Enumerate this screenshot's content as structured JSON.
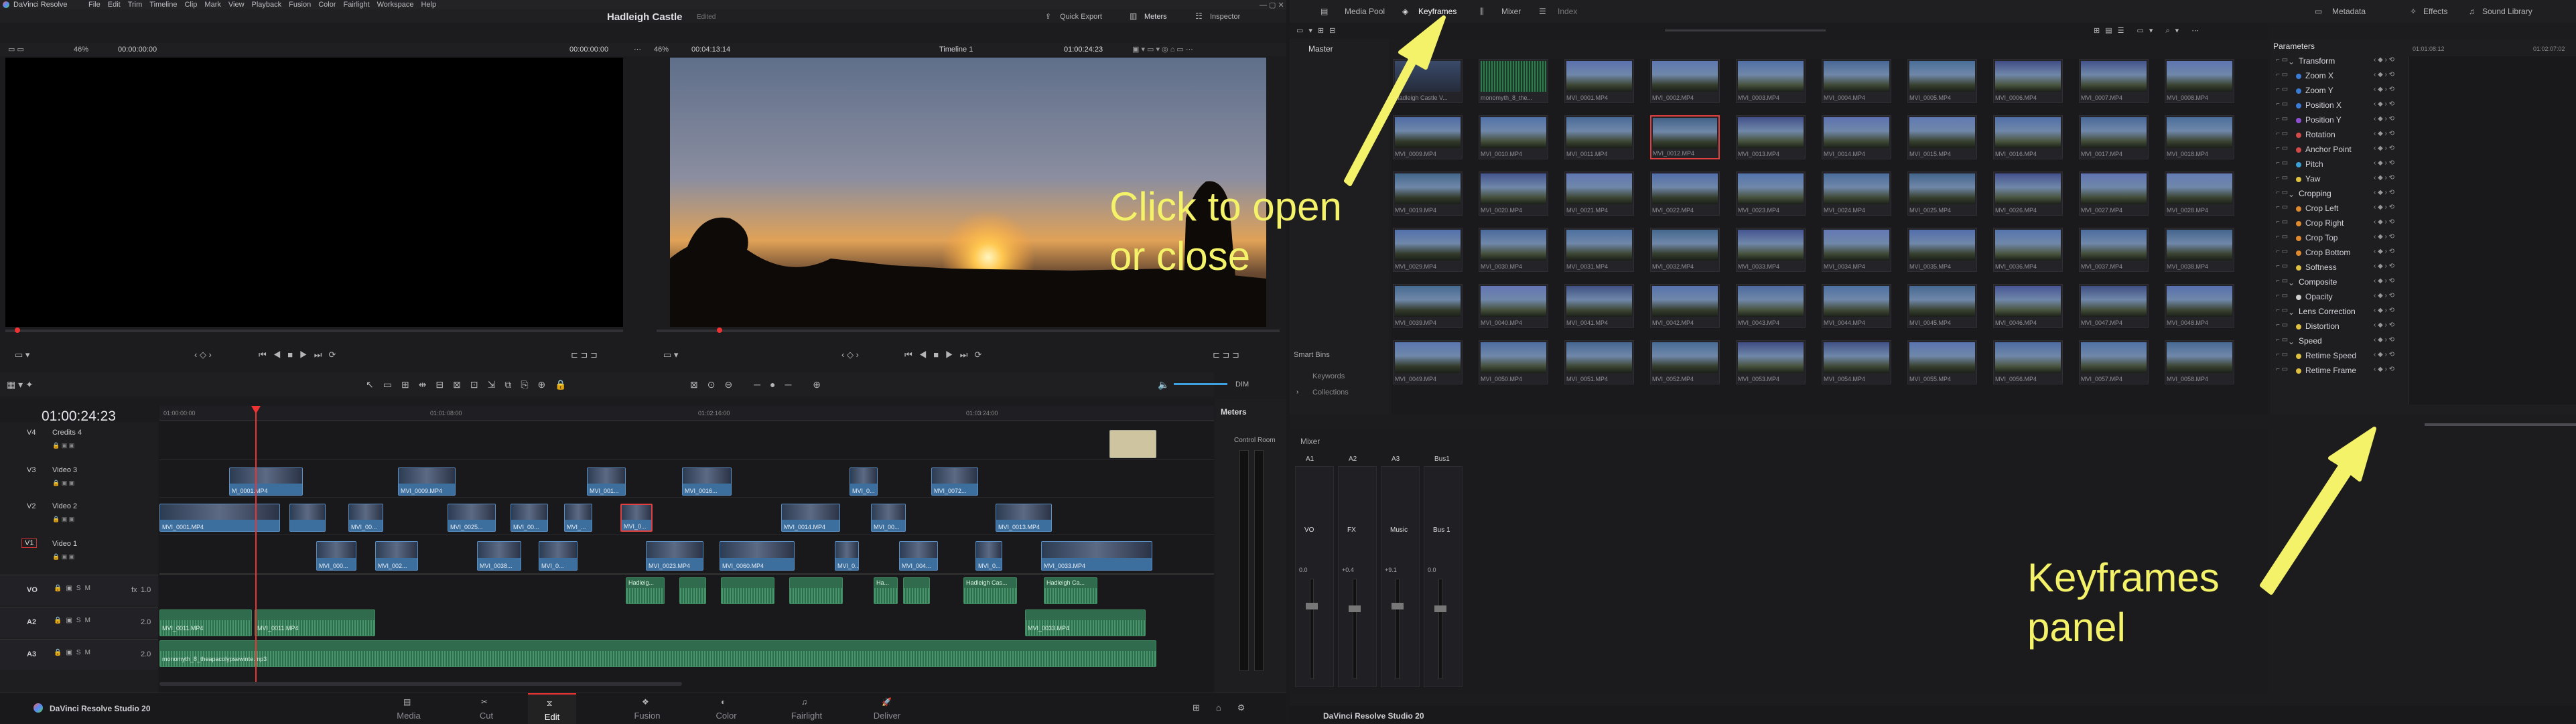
{
  "app": {
    "name_left": "DaVinci Resolve",
    "menu": [
      "File",
      "Edit",
      "Trim",
      "Timeline",
      "Clip",
      "Mark",
      "View",
      "Playback",
      "Fusion",
      "Color",
      "Fairlight",
      "Workspace",
      "Help"
    ],
    "project_title": "Hadleigh Castle",
    "project_status": "Edited",
    "top_buttons": {
      "quick_export": "Quick Export",
      "meters": "Meters",
      "inspector": "Inspector"
    },
    "right_top_tabs": {
      "media_pool": "Media Pool",
      "keyframes": "Keyframes",
      "mixer": "Mixer",
      "index": "Index",
      "metadata": "Metadata",
      "effects": "Effects",
      "sound_library": "Sound Library"
    }
  },
  "source_viewer": {
    "zoom": "46%",
    "timecode_left": "00:00:00:00",
    "timecode_right": "00:00:00:00"
  },
  "timeline_viewer": {
    "zoom": "46%",
    "duration": "00:04:13:14",
    "timeline_name": "Timeline 1",
    "timecode": "01:00:24:23"
  },
  "timeline": {
    "current_tc": "01:00:24:23",
    "ruler": [
      "01:00:00:00",
      "01:01:08:00",
      "01:02:16:00",
      "01:03:24:00"
    ],
    "dim_label": "DIM",
    "tracks": {
      "v4": {
        "id": "V4",
        "name": "Credits 4"
      },
      "v3": {
        "id": "V3",
        "name": "Video 3"
      },
      "v2": {
        "id": "V2",
        "name": "Video 2"
      },
      "v1": {
        "id": "V1",
        "name": "Video 1"
      },
      "vo": {
        "id": "VO",
        "fx": "fx",
        "level": "1.0"
      },
      "a2": {
        "id": "A2",
        "level": "2.0"
      },
      "a3": {
        "id": "A3",
        "level": "2.0"
      }
    },
    "clips_v3": [
      "M_0001.MP4",
      "MVI_0009.MP4",
      "MVI_001...",
      "MVI_0016...",
      "MVI_0...",
      "MVI_0072..."
    ],
    "clips_v2": [
      "MVI_0001.MP4",
      "MVI_00...",
      "MVI_0025...",
      "MVI_00...",
      "MVI_...",
      "MVI_0...",
      "MVI_0014.MP4",
      "MVI_00...",
      "MVI_0013.MP4"
    ],
    "clips_v1": [
      "MVI_000...",
      "MVI_002...",
      "MVI_0038...",
      "MVI_0...",
      "MVI_0023.MP4",
      "MVI_0060.MP4",
      "MVI_0...",
      "MVI_004...",
      "MVI_0...",
      "MVI_0033.MP4"
    ],
    "clips_vo": [
      "Hadleig...",
      "Ha...",
      "Hadleigh Cas...",
      "Hadleigh Ca..."
    ],
    "clips_a2": [
      "MVI_0011.MP4",
      "MVI_0011.MP4",
      "MVI_0033.MP4"
    ],
    "clip_a3": "monomyth_8_theapacolypsewinte.mp3"
  },
  "meters": {
    "title": "Meters",
    "control_room": "Control Room"
  },
  "pages": [
    "Media",
    "Cut",
    "Edit",
    "Fusion",
    "Color",
    "Fairlight",
    "Deliver"
  ],
  "brand": "DaVinci Resolve Studio 20",
  "media_pool": {
    "master": "Master",
    "smart_bins": "Smart Bins",
    "keywords": "Keywords",
    "collections": "Collections",
    "clips": [
      "Hadleigh Castle V...",
      "monomyth_8_the...",
      "MVI_0001.MP4",
      "MVI_0002.MP4",
      "MVI_0003.MP4",
      "MVI_0004.MP4",
      "MVI_0005.MP4",
      "MVI_0006.MP4",
      "MVI_0007.MP4",
      "MVI_0008.MP4",
      "MVI_0009.MP4",
      "MVI_0010.MP4",
      "MVI_0011.MP4",
      "MVI_0012.MP4",
      "MVI_0013.MP4",
      "MVI_0014.MP4",
      "MVI_0015.MP4",
      "MVI_0016.MP4",
      "MVI_0017.MP4",
      "MVI_0018.MP4",
      "MVI_0019.MP4",
      "MVI_0020.MP4",
      "MVI_0021.MP4",
      "MVI_0022.MP4",
      "MVI_0023.MP4",
      "MVI_0024.MP4",
      "MVI_0025.MP4",
      "MVI_0026.MP4",
      "MVI_0027.MP4",
      "MVI_0028.MP4",
      "MVI_0029.MP4",
      "MVI_0030.MP4",
      "MVI_0031.MP4",
      "MVI_0032.MP4",
      "MVI_0033.MP4",
      "MVI_0034.MP4",
      "MVI_0035.MP4",
      "MVI_0036.MP4",
      "MVI_0037.MP4",
      "MVI_0038.MP4",
      "MVI_0039.MP4",
      "MVI_0040.MP4",
      "MVI_0041.MP4",
      "MVI_0042.MP4",
      "MVI_0043.MP4",
      "MVI_0044.MP4",
      "MVI_0045.MP4",
      "MVI_0046.MP4",
      "MVI_0047.MP4",
      "MVI_0048.MP4",
      "MVI_0049.MP4",
      "MVI_0050.MP4",
      "MVI_0051.MP4",
      "MVI_0052.MP4",
      "MVI_0053.MP4",
      "MVI_0054.MP4",
      "MVI_0055.MP4",
      "MVI_0056.MP4",
      "MVI_0057.MP4",
      "MVI_0058.MP4"
    ]
  },
  "mixer": {
    "title": "Mixer",
    "channels": [
      "A1",
      "A2",
      "A3",
      "Bus1"
    ],
    "labels": [
      "VO",
      "FX",
      "Music",
      "Bus 1"
    ],
    "levels": [
      "0.0",
      "+0.4",
      "+9.1",
      "0.0"
    ]
  },
  "keyframes": {
    "title": "Parameters",
    "ruler": [
      "01:01:08:12",
      "01:02:07:02"
    ],
    "params": [
      {
        "label": "Transform",
        "type": "group",
        "color": ""
      },
      {
        "label": "Zoom X",
        "type": "item",
        "color": "#3a7bd5"
      },
      {
        "label": "Zoom Y",
        "type": "item",
        "color": "#3a7bd5"
      },
      {
        "label": "Position X",
        "type": "item",
        "color": "#3a7bd5"
      },
      {
        "label": "Position Y",
        "type": "item",
        "color": "#8e4fd0"
      },
      {
        "label": "Rotation",
        "type": "item",
        "color": "#d44a4a"
      },
      {
        "label": "Anchor Point",
        "type": "item",
        "color": "#d44a4a"
      },
      {
        "label": "Pitch",
        "type": "item",
        "color": "#3aa0d5"
      },
      {
        "label": "Yaw",
        "type": "item",
        "color": "#e0c040"
      },
      {
        "label": "Cropping",
        "type": "group",
        "color": ""
      },
      {
        "label": "Crop Left",
        "type": "item",
        "color": "#e08a30"
      },
      {
        "label": "Crop Right",
        "type": "item",
        "color": "#e08a30"
      },
      {
        "label": "Crop Top",
        "type": "item",
        "color": "#e08a30"
      },
      {
        "label": "Crop Bottom",
        "type": "item",
        "color": "#e08a30"
      },
      {
        "label": "Softness",
        "type": "item",
        "color": "#e0c040"
      },
      {
        "label": "Composite",
        "type": "group",
        "color": ""
      },
      {
        "label": "Opacity",
        "type": "item",
        "color": "#cfcfcf"
      },
      {
        "label": "Lens Correction",
        "type": "group",
        "color": ""
      },
      {
        "label": "Distortion",
        "type": "item",
        "color": "#e0c040"
      },
      {
        "label": "Speed",
        "type": "group",
        "color": ""
      },
      {
        "label": "Retime Speed",
        "type": "item",
        "color": "#e0c040"
      },
      {
        "label": "Retime Frame",
        "type": "item",
        "color": "#e0c040"
      }
    ]
  },
  "annotations": {
    "open_close_1": "Click to open",
    "open_close_2": "or close",
    "panel_1": "Keyframes",
    "panel_2": "panel",
    "arrow_color": "#f4f268"
  }
}
